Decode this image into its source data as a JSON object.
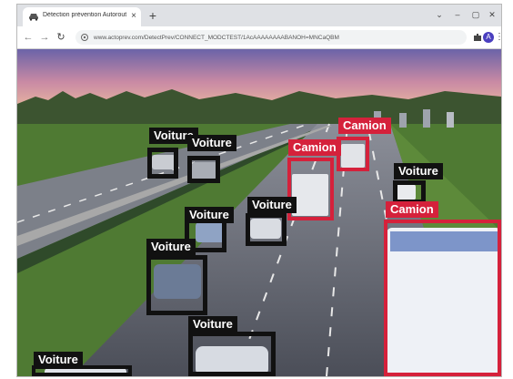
{
  "browser": {
    "tab_title": "Détection prévention Autorout...",
    "url": "www.actoprev.com/DetectPrev/CONNECT_MODCTEST/1AcAAAAAAAABANOH=MNCaQBM",
    "profile_initial": "A",
    "window_controls": [
      "⌄",
      "–",
      "▢",
      "✕"
    ]
  },
  "detections": {
    "labels": [
      {
        "text": "Voiture",
        "class": "car"
      },
      {
        "text": "Voiture",
        "class": "car"
      },
      {
        "text": "Camion",
        "class": "truck"
      },
      {
        "text": "Camion",
        "class": "truck"
      },
      {
        "text": "Voiture",
        "class": "car"
      },
      {
        "text": "Camion",
        "class": "truck"
      },
      {
        "text": "Voiture",
        "class": "car"
      },
      {
        "text": "Voiture",
        "class": "car"
      },
      {
        "text": "Voiture",
        "class": "car"
      },
      {
        "text": "Voiture",
        "class": "car"
      },
      {
        "text": "Voiture",
        "class": "car"
      }
    ],
    "colors": {
      "car": "#111111",
      "truck": "#d5213b"
    }
  }
}
